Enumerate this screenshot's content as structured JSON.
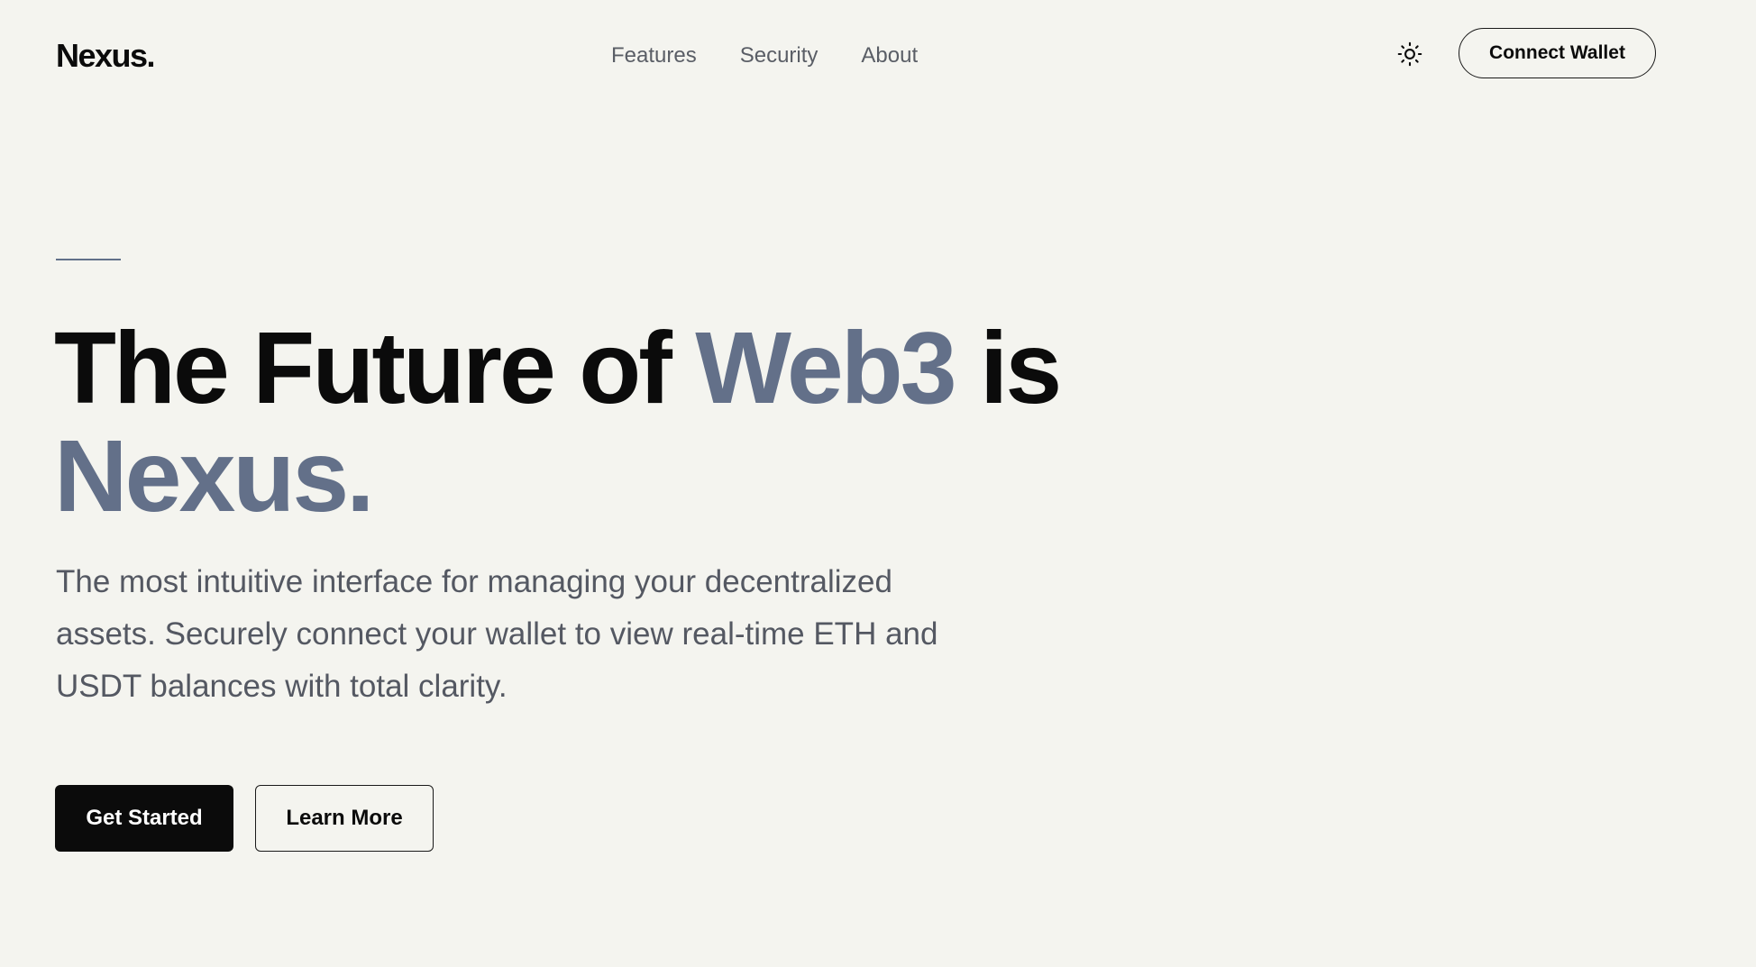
{
  "header": {
    "logo": "Nexus.",
    "nav": [
      {
        "label": "Features"
      },
      {
        "label": "Security"
      },
      {
        "label": "About"
      }
    ],
    "theme_toggle_icon": "sun-icon",
    "connect_label": "Connect Wallet"
  },
  "hero": {
    "headline_part1": "The Future of ",
    "headline_highlight": "Web3",
    "headline_part2": " is",
    "headline_line2": "Nexus.",
    "subtext": "The most intuitive interface for managing your decentralized assets. Securely connect your wallet to view real-time ETH and USDT balances with total clarity.",
    "primary_cta": "Get Started",
    "secondary_cta": "Learn More"
  },
  "colors": {
    "background": "#f4f4ef",
    "text": "#0b0b0b",
    "accent": "#637089",
    "muted_text": "#545862"
  }
}
